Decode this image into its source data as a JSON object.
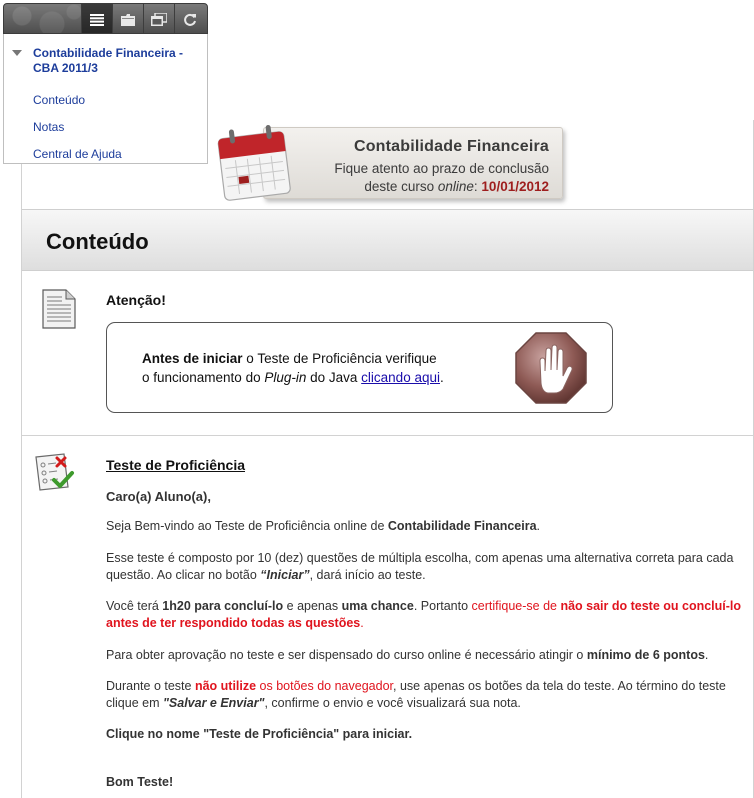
{
  "toolbar": {
    "buttons": [
      {
        "name": "menu-list-icon",
        "active": true
      },
      {
        "name": "folder-icon",
        "active": false
      },
      {
        "name": "windows-icon",
        "active": false
      },
      {
        "name": "refresh-icon",
        "active": false
      }
    ]
  },
  "menu": {
    "course_title": "Contabilidade Financeira - CBA 2011/3",
    "links": [
      "Conteúdo",
      "Notas",
      "Central de Ajuda"
    ]
  },
  "banner": {
    "title": "Contabilidade Financeira",
    "line1": "Fique atento ao prazo de conclusão",
    "line2_prefix": "deste curso ",
    "line2_em": "online",
    "line2_colon": ": ",
    "deadline": "10/01/2012"
  },
  "page": {
    "title": "Conteúdo"
  },
  "item1": {
    "title": "Atenção!",
    "notice": {
      "bold_start": "Antes de iniciar",
      "text1": " o Teste de Proficiência verifique",
      "text2_prefix": "o funcionamento do ",
      "plugin_em": "Plug-in",
      "text2_middle": " do Java ",
      "link": "clicando aqui",
      "text2_suffix": "."
    }
  },
  "item2": {
    "title": "Teste de Proficiência",
    "greeting": "Caro(a) Aluno(a),",
    "welcome_prefix": "Seja Bem-vindo ao Teste de Proficiência online de ",
    "welcome_bold": "Contabilidade Financeira",
    "welcome_suffix": ".",
    "p2_prefix": "Esse teste é composto por 10 (dez) questões de múltipla escolha, com apenas uma alternativa correta para cada questão. Ao clicar no botão ",
    "p2_button": "“Iniciar”",
    "p2_suffix": ", dará início ao teste.",
    "p3_a": "Você terá ",
    "p3_time": "1h20 para concluí-lo",
    "p3_b": " e apenas ",
    "p3_chance": "uma chance",
    "p3_c": ". Portanto ",
    "p3_red": "certifique-se de ",
    "p3_red_bold": "não sair do teste ou concluí-lo antes de ter respondido todas as questões",
    "p3_end": ".",
    "p4_prefix": "Para obter aprovação no teste e ser dispensado do curso online é necessário atingir o ",
    "p4_bold": "mínimo de 6 pontos",
    "p4_suffix": ".",
    "p5_a": "Durante o teste ",
    "p5_red_bold": "não utilize",
    "p5_red": " os botões do navegador",
    "p5_b": ", use apenas os botões da tela do teste. Ao término do teste clique em ",
    "p5_bold": "\"Salvar e Enviar\"",
    "p5_c": ", confirme o envio e você visualizará sua nota.",
    "p6": "Clique no nome \"Teste de Proficiência\" para iniciar.",
    "p7": "Bom Teste!"
  },
  "colors": {
    "link": "#1d3d9b",
    "alert_red": "#e0141e",
    "deadline": "#9e1e1e"
  }
}
